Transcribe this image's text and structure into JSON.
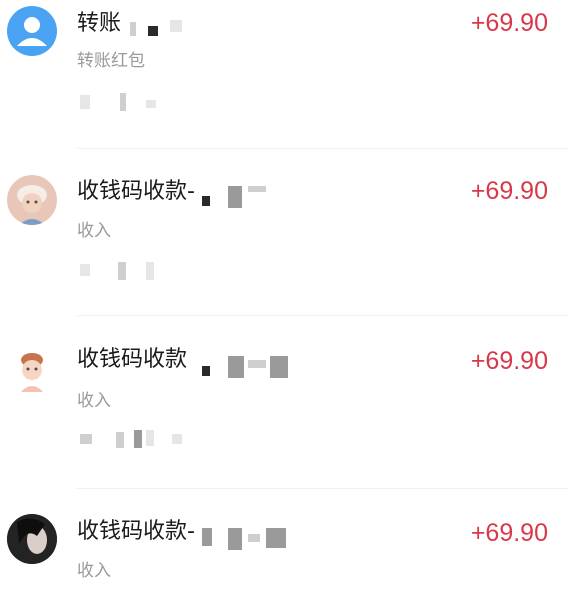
{
  "transactions": [
    {
      "title": "转账",
      "subtitle": "转账红包",
      "amount": "+69.90",
      "avatar_icon": "default-user-avatar-icon"
    },
    {
      "title": "收钱码收款-",
      "subtitle": "收入",
      "amount": "+69.90",
      "avatar_icon": "cartoon-avatar-icon"
    },
    {
      "title": "收钱码收款",
      "subtitle": "收入",
      "amount": "+69.90",
      "avatar_icon": "cartoon-avatar-icon"
    },
    {
      "title": "收钱码收款-",
      "subtitle": "收入",
      "amount": "+69.90",
      "avatar_icon": "photo-avatar-icon"
    }
  ],
  "colors": {
    "amount": "#d8394a",
    "avatar_blue": "#4aa3f2"
  }
}
